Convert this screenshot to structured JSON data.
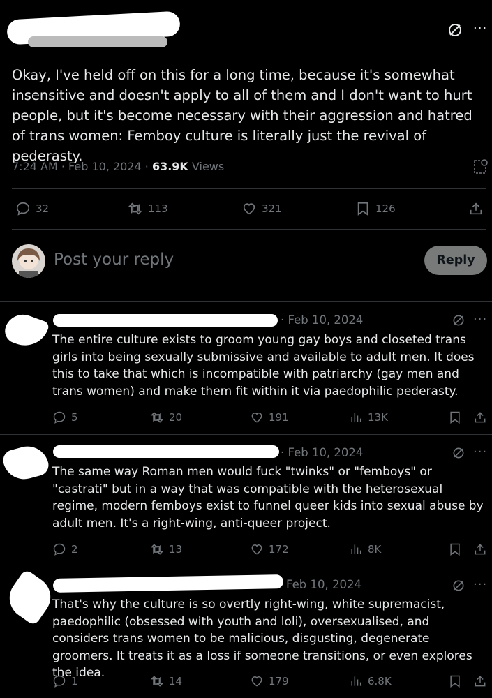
{
  "tweet": {
    "text": "Okay, I've held off on this for a long time, because it's somewhat insensitive and doesn't apply to all of them and I don't want to hurt people, but it's become necessary with their aggression and hatred of trans women: Femboy culture is literally just the revival of pederasty.",
    "time": "7:24 AM · Feb 10, 2024 · ",
    "views_count": "63.9K",
    "views_label": " Views",
    "stats": {
      "replies": "32",
      "reposts": "113",
      "likes": "321",
      "bookmarks": "126"
    }
  },
  "composer": {
    "placeholder": "Post your reply",
    "button_label": "Reply"
  },
  "replies": [
    {
      "date": "· Feb 10, 2024",
      "text": "The entire culture exists to groom young gay boys and closeted trans girls into being sexually submissive and available to adult men. It does this to take that which is incompatible with patriarchy (gay men and trans women) and make them fit within it via paedophilic pederasty.",
      "replies": "5",
      "reposts": "20",
      "likes": "191",
      "views": "13K"
    },
    {
      "date": "· Feb 10, 2024",
      "text": "The same way Roman men would fuck \"twinks\" or \"femboys\" or \"castrati\" but in a way that was compatible with the heterosexual regime, modern femboys exist to funnel queer kids into sexual abuse by adult men. It's a right-wing, anti-queer project.",
      "replies": "2",
      "reposts": "13",
      "likes": "172",
      "views": "8K"
    },
    {
      "date": "Feb 10, 2024",
      "text": "That's why the culture is so overtly right-wing, white supremacist, paedophilic (obsessed with youth and loli), oversexualised, and considers trans women to be malicious, disgusting, degenerate groomers. It treats it as a loss if someone transitions, or even explores the idea.",
      "replies": "1",
      "reposts": "14",
      "likes": "179",
      "views": "6.8K"
    }
  ],
  "icons": [
    "grok-icon",
    "more-icon",
    "reply-icon",
    "repost-icon",
    "like-icon",
    "bookmark-icon",
    "share-icon",
    "views-icon",
    "analytics-icon"
  ],
  "colors": {
    "background": "#000000",
    "text": "#e7e9ea",
    "muted": "#71767b",
    "divider": "#2f3336",
    "reply_button": "#787a7a"
  }
}
